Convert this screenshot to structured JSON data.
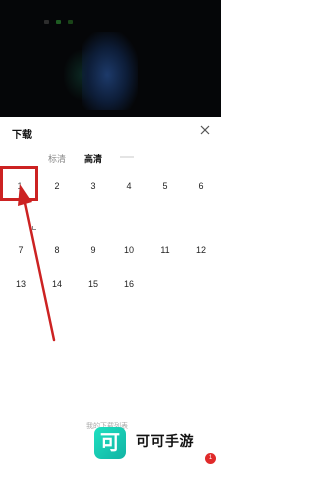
{
  "sheet": {
    "title": "下载",
    "quality_options": [
      "标清",
      "高清"
    ],
    "selected_quality": "高清"
  },
  "episodes": [
    {
      "label": "1"
    },
    {
      "label": "2"
    },
    {
      "label": "3"
    },
    {
      "label": "4"
    },
    {
      "label": "5"
    },
    {
      "label": "6"
    },
    {
      "label": "7"
    },
    {
      "label": "8"
    },
    {
      "label": "9"
    },
    {
      "label": "10"
    },
    {
      "label": "11"
    },
    {
      "label": "12"
    },
    {
      "label": "13"
    },
    {
      "label": "14"
    },
    {
      "label": "15"
    },
    {
      "label": "16"
    }
  ],
  "footer": {
    "link_text": "我的下载列表"
  },
  "watermark": {
    "brand": "可可手游",
    "logo_char": "可",
    "badge": "1"
  },
  "colors": {
    "highlight": "#cc2222",
    "logo": "#1ee0c0",
    "video_bg": "#050608"
  },
  "icons": [
    "close-icon",
    "arrow-pointer-icon"
  ]
}
